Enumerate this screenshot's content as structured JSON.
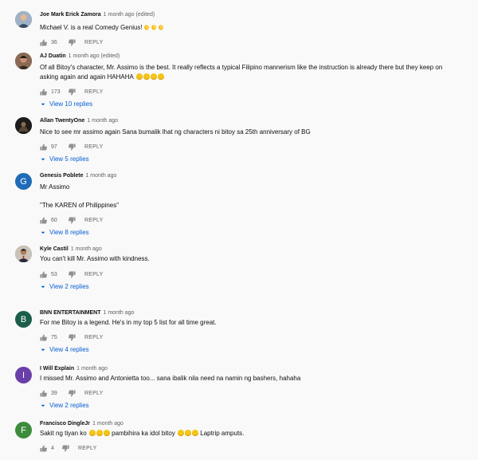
{
  "comments": [
    {
      "author": "Joe Mark Erick Zamora",
      "time": "1 month ago (edited)",
      "text": [
        "Michael V. is a real Comedy Genius!"
      ],
      "emojis": [
        "clapping-hands",
        "clapping-hands",
        "clapping-hands"
      ],
      "likes": "36",
      "reply_label": "REPLY",
      "view_replies": "",
      "avatar": {
        "type": "photo",
        "color": "#7a8fa6"
      }
    },
    {
      "author": "AJ Duatin",
      "time": "1 month ago (edited)",
      "text": [
        "Of all Bitoy's character, Mr. Assimo is the best. It really reflects a typical Filipino mannerism like the instruction is already there but they keep on asking again and again HAHAHA"
      ],
      "emojis": [
        "rolling-laughing-face",
        "rolling-laughing-face",
        "rolling-laughing-face",
        "rolling-laughing-face"
      ],
      "likes": "173",
      "reply_label": "REPLY",
      "view_replies": "View 10 replies",
      "avatar": {
        "type": "photo",
        "color": "#6b4a3a"
      }
    },
    {
      "author": "Allan TwentyOne",
      "time": "1 month ago",
      "text": [
        "Nice to see mr assimo again Sana bumalik lhat ng characters ni bitoy sa 25th anniversary of BG"
      ],
      "emojis": [],
      "likes": "97",
      "reply_label": "REPLY",
      "view_replies": "View 5 replies",
      "avatar": {
        "type": "photo",
        "color": "#2b2b2b"
      }
    },
    {
      "author": "Genesis Poblete",
      "time": "1 month ago",
      "text": [
        "Mr Assimo",
        "\"The KAREN of Philippines\""
      ],
      "emojis": [],
      "likes": "60",
      "reply_label": "REPLY",
      "view_replies": "View 8 replies",
      "avatar": {
        "type": "letter",
        "letter": "G",
        "color": "#1e6bb8"
      }
    },
    {
      "author": "Kyle Castil",
      "time": "1 month ago",
      "text": [
        "You can't kill Mr. Assimo with kindness."
      ],
      "emojis": [],
      "likes": "53",
      "reply_label": "REPLY",
      "view_replies": "View 2 replies",
      "avatar": {
        "type": "photo",
        "color": "#8a6f5a"
      }
    },
    {
      "author": "BNN ENTERTAINMENT",
      "time": "1 month ago",
      "text": [
        "For me Bitoy is a legend. He's in my top 5 list for all time great."
      ],
      "emojis": [],
      "likes": "75",
      "reply_label": "REPLY",
      "view_replies": "View 4 replies",
      "avatar": {
        "type": "letter",
        "letter": "B",
        "color": "#1b5e4a"
      }
    },
    {
      "author": "I Will Explain",
      "time": "1 month ago",
      "text": [
        "I missed Mr. Assimo and Antonietta too... sana ibalik nila need na namin ng bashers, hahaha"
      ],
      "emojis": [],
      "likes": "39",
      "reply_label": "REPLY",
      "view_replies": "View 2 replies",
      "avatar": {
        "type": "letter",
        "letter": "I",
        "color": "#6a3fa8"
      }
    },
    {
      "author": "Francisco DingleJr",
      "time": "1 month ago",
      "text_parts": [
        "Sakit ng tiyan ko",
        "pambihira ka idol bitoy",
        "Laptrip amputs."
      ],
      "emoji_groups": [
        3,
        3
      ],
      "likes": "4",
      "reply_label": "REPLY",
      "view_replies": "",
      "avatar": {
        "type": "letter",
        "letter": "F",
        "color": "#3d8b3d"
      }
    }
  ]
}
